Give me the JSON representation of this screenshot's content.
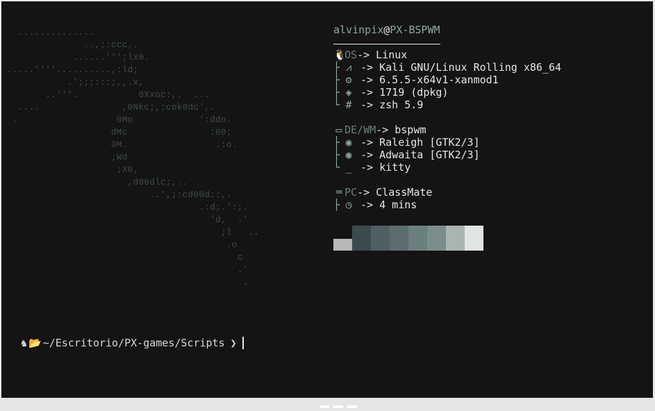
{
  "ascii_art": "   ..............\n               ..,;:ccc,.\n             ......''';lx0.\n .....''''..........,:ld;\n            .';;;:::;,,.x,\n        ..'''.           0Xxoc:,.  ...\n   ....               ,0Nkc;,;cok0dc',.\n  .                  0Mo            ':ddo.\n                    dMc               :00;\n                    0M.                .:o.\n                    ;Wd\n                     ;X0,\n                       ,d00dlc;,..\n                           ..',;:cd00d::,.\n                                    .:d;.':;.\n                                      'd,  .'\n                                        ;l   ..\n                                         .o\n                                           c\n                                           .'\n                                            .",
  "user": {
    "name": "alvinpix",
    "at": "@",
    "host": "PX-BSPWM"
  },
  "os": {
    "label": "OS",
    "arrow": "-> ",
    "value": "Linux"
  },
  "os_items": [
    {
      "icon": "kali-icon",
      "value": "Kali GNU/Linux Rolling x86_64"
    },
    {
      "icon": "gear-icon",
      "value": "6.5.5-x64v1-xanmod1"
    },
    {
      "icon": "package-icon",
      "value": "1719 (dpkg)"
    },
    {
      "icon": "hash-icon",
      "value": "zsh 5.9"
    }
  ],
  "de": {
    "label": "DE/WM",
    "arrow": "-> ",
    "value": "bspwm"
  },
  "de_items": [
    {
      "icon": "theme-icon",
      "value": "Raleigh [GTK2/3]"
    },
    {
      "icon": "theme-icon",
      "value": "Adwaita [GTK2/3]"
    },
    {
      "icon": "terminal-icon",
      "value": "kitty"
    }
  ],
  "pc": {
    "label": "PC",
    "arrow": "-> ",
    "value": "ClassMate"
  },
  "pc_items": [
    {
      "icon": "clock-icon",
      "value": "4 mins"
    }
  ],
  "palette": [
    "#b8b8b8",
    "#3b4b4d",
    "#4f6062",
    "#5b6d6e",
    "#6c7f7f",
    "#7b8d8b",
    "#a9b5b1",
    "#e2e4e1"
  ],
  "prompt": {
    "path": "~/Escritorio/PX-games/Scripts",
    "symbol": "❯"
  }
}
